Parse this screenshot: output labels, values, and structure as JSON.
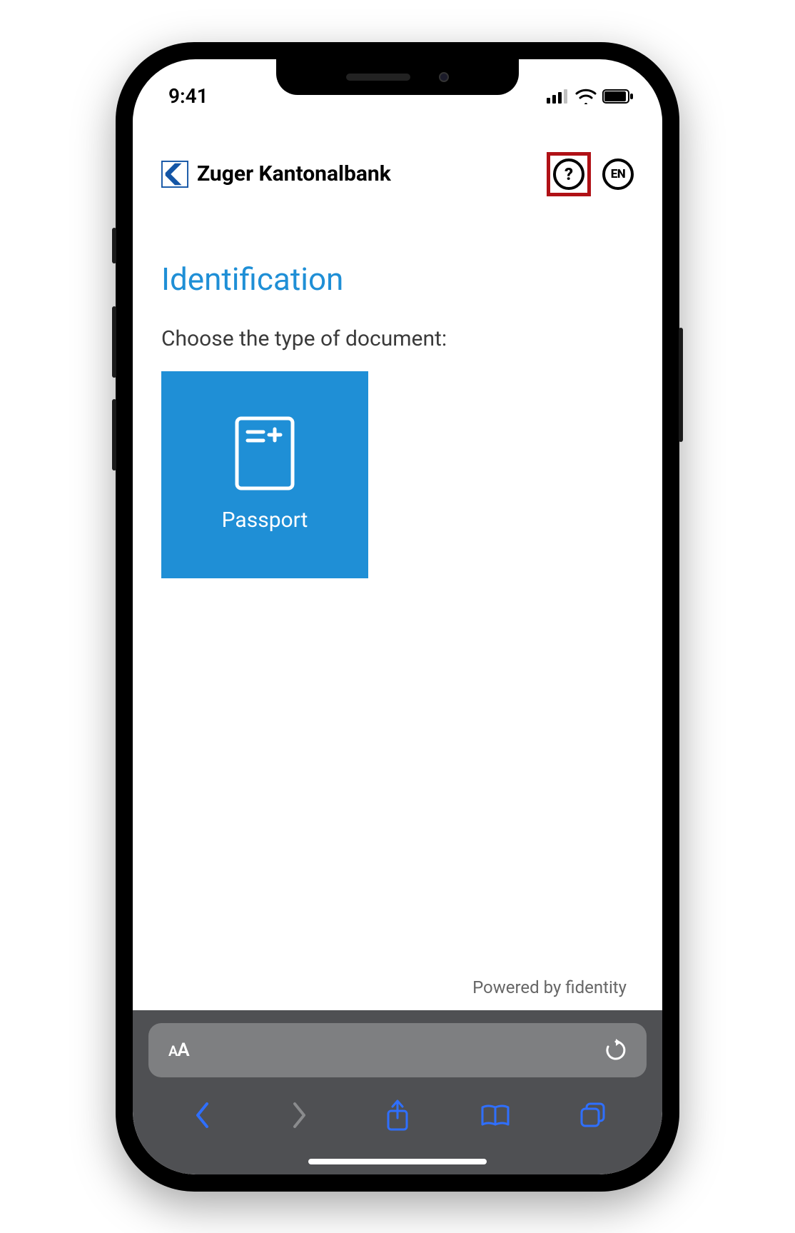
{
  "status_bar": {
    "time": "9:41"
  },
  "header": {
    "brand": "Zuger Kantonalbank",
    "language": "EN"
  },
  "main": {
    "title": "Identification",
    "subtitle": "Choose the type of document:",
    "tiles": [
      {
        "label": "Passport"
      }
    ],
    "powered_by": "Powered by fidentity"
  },
  "browser": {
    "text_size_label": "AA"
  },
  "highlight": {
    "help_button": true,
    "color": "#b01116"
  }
}
